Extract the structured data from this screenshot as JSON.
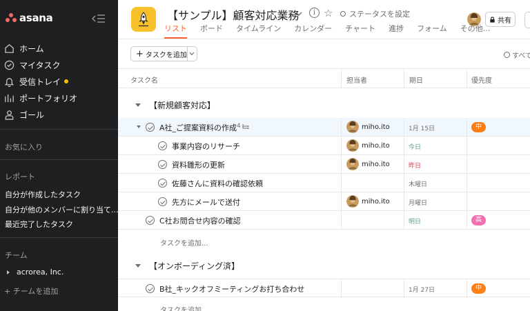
{
  "sidebar": {
    "logo_text": "asana",
    "nav": [
      {
        "label": "ホーム",
        "icon": "home-icon"
      },
      {
        "label": "マイタスク",
        "icon": "check-circle-icon"
      },
      {
        "label": "受信トレイ",
        "icon": "bell-icon"
      },
      {
        "label": "ポートフォリオ",
        "icon": "bar-chart-icon"
      },
      {
        "label": "ゴール",
        "icon": "person-icon"
      }
    ],
    "favorites_label": "お気に入り",
    "reports_label": "レポート",
    "reports": [
      "自分が作成したタスク",
      "自分が他のメンバーに割り当て...",
      "最近完了したタスク"
    ],
    "teams_label": "チーム",
    "team_name": "acrorea, Inc.",
    "add_team": "+ チームを追加"
  },
  "header": {
    "title": "【サンプル】顧客対応業務",
    "status": "ステータスを設定",
    "tabs": [
      "リスト",
      "ボード",
      "タイムライン",
      "カレンダー",
      "チャート",
      "進捗",
      "フォーム",
      "その他..."
    ],
    "share": "共有"
  },
  "toolbar": {
    "add_task": "タスクを追加",
    "filter": "すべて"
  },
  "columns": {
    "name": "タスク名",
    "assignee": "担当者",
    "due": "期日",
    "priority": "優先度"
  },
  "sections": [
    {
      "title": "【新規顧客対応】",
      "tasks": [
        {
          "name": "A社_ご提案資料の作成",
          "subcount": "4",
          "assignee": "miho.ito",
          "due": "1月 15日",
          "priority": "中"
        },
        {
          "name": "事業内容のリサーチ",
          "assignee": "miho.ito",
          "due": "今日"
        },
        {
          "name": "資料雛形の更新",
          "assignee": "miho.ito",
          "due": "昨日"
        },
        {
          "name": "佐藤さんに資料の確認依頼",
          "assignee": "",
          "due": "木曜日"
        },
        {
          "name": "先方にメールで送付",
          "assignee": "miho.ito",
          "due": "月曜日"
        },
        {
          "name": "C社お問合せ内容の確認",
          "assignee": "",
          "due": "明日",
          "priority": "高"
        }
      ],
      "add_task": "タスクを追加..."
    },
    {
      "title": "【オンボーディング済】",
      "tasks": [
        {
          "name": "B社_キックオフミーティングお打ち合わせ",
          "assignee": "",
          "due": "1月 27日",
          "priority": "中"
        }
      ],
      "add_task": "タスクを追加..."
    }
  ],
  "colors": {
    "sidebar_bg": "#1e1f21",
    "accent_orange": "#fd612c",
    "tab_active": "#1e1f21",
    "due_today": "#58a182",
    "due_overdue": "#e8384f",
    "prio_medium": "#fd7e14",
    "prio_high": "#f26fb2",
    "project_icon": "#f8c12a"
  }
}
